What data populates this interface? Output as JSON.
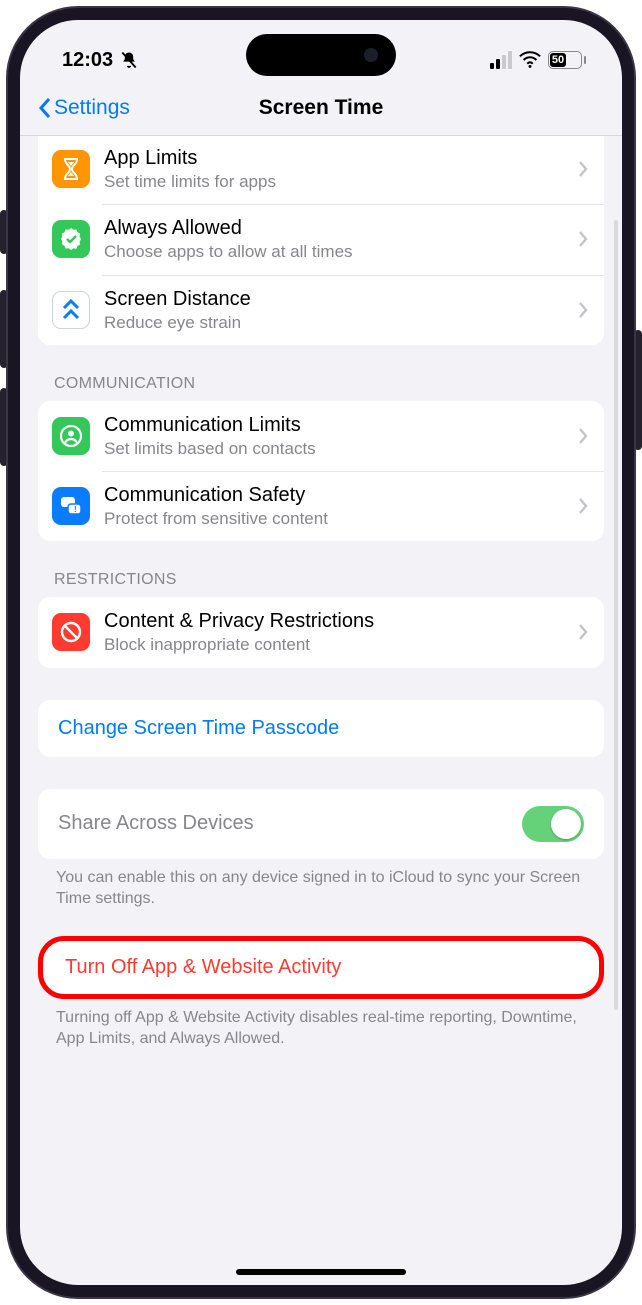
{
  "status": {
    "time": "12:03",
    "battery": "50"
  },
  "nav": {
    "back": "Settings",
    "title": "Screen Time"
  },
  "section1": {
    "items": [
      {
        "title": "App Limits",
        "sub": "Set time limits for apps",
        "icon": "hourglass",
        "color": "#ff9500"
      },
      {
        "title": "Always Allowed",
        "sub": "Choose apps to allow at all times",
        "icon": "seal-check",
        "color": "#34c759"
      },
      {
        "title": "Screen Distance",
        "sub": "Reduce eye strain",
        "icon": "chevrons-up",
        "color": "#ffffff"
      }
    ]
  },
  "section2": {
    "header": "COMMUNICATION",
    "items": [
      {
        "title": "Communication Limits",
        "sub": "Set limits based on contacts",
        "icon": "person-circle",
        "color": "#34c759"
      },
      {
        "title": "Communication Safety",
        "sub": "Protect from sensitive content",
        "icon": "chat-bubbles",
        "color": "#0a7cff"
      }
    ]
  },
  "section3": {
    "header": "RESTRICTIONS",
    "items": [
      {
        "title": "Content & Privacy Restrictions",
        "sub": "Block inappropriate content",
        "icon": "no-sign",
        "color": "#ff3b30"
      }
    ]
  },
  "passcode": {
    "label": "Change Screen Time Passcode"
  },
  "share": {
    "label": "Share Across Devices",
    "note": "You can enable this on any device signed in to iCloud to sync your Screen Time settings."
  },
  "turnoff": {
    "label": "Turn Off App & Website Activity",
    "note": "Turning off App & Website Activity disables real-time reporting, Downtime, App Limits, and Always Allowed."
  }
}
